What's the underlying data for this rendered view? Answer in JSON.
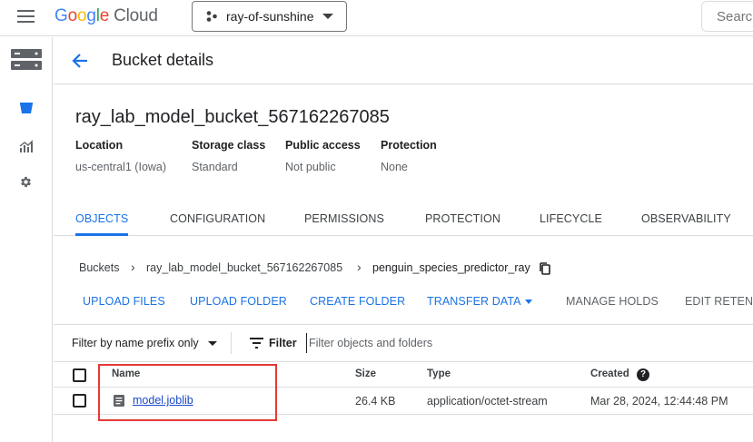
{
  "header": {
    "logo_google": [
      "G",
      "o",
      "o",
      "g",
      "l",
      "e"
    ],
    "logo_cloud": "Cloud",
    "project": "ray-of-sunshine",
    "search_placeholder": "Search"
  },
  "rail": {
    "items": [
      {
        "icon": "storage-icon"
      },
      {
        "icon": "bucket-icon"
      },
      {
        "icon": "monitoring-icon"
      },
      {
        "icon": "settings-icon"
      }
    ]
  },
  "page": {
    "title": "Bucket details",
    "bucket_name": "ray_lab_model_bucket_567162267085"
  },
  "meta": [
    {
      "label": "Location",
      "value": "us-central1 (Iowa)"
    },
    {
      "label": "Storage class",
      "value": "Standard"
    },
    {
      "label": "Public access",
      "value": "Not public"
    },
    {
      "label": "Protection",
      "value": "None"
    }
  ],
  "tabs": [
    {
      "label": "OBJECTS",
      "active": true
    },
    {
      "label": "CONFIGURATION",
      "active": false
    },
    {
      "label": "PERMISSIONS",
      "active": false
    },
    {
      "label": "PROTECTION",
      "active": false
    },
    {
      "label": "LIFECYCLE",
      "active": false
    },
    {
      "label": "OBSERVABILITY",
      "active": false
    }
  ],
  "breadcrumb": {
    "root": "Buckets",
    "bucket": "ray_lab_model_bucket_567162267085",
    "folder": "penguin_species_predictor_ray",
    "separator": "›"
  },
  "actions": {
    "upload_files": "UPLOAD FILES",
    "upload_folder": "UPLOAD FOLDER",
    "create_folder": "CREATE FOLDER",
    "transfer_data": "TRANSFER DATA",
    "manage_holds": "MANAGE HOLDS",
    "edit_retention": "EDIT RETENT"
  },
  "filter": {
    "prefix_label": "Filter by name prefix only",
    "filter_label": "Filter",
    "input_placeholder": "Filter objects and folders"
  },
  "table": {
    "columns": {
      "name": "Name",
      "size": "Size",
      "type": "Type",
      "created": "Created"
    },
    "rows": [
      {
        "name": "model.joblib",
        "size": "26.4 KB",
        "type": "application/octet-stream",
        "created": "Mar 28, 2024, 12:44:48 PM"
      }
    ]
  },
  "colors": {
    "accent": "#1a73e8",
    "highlight": "#e53935"
  }
}
